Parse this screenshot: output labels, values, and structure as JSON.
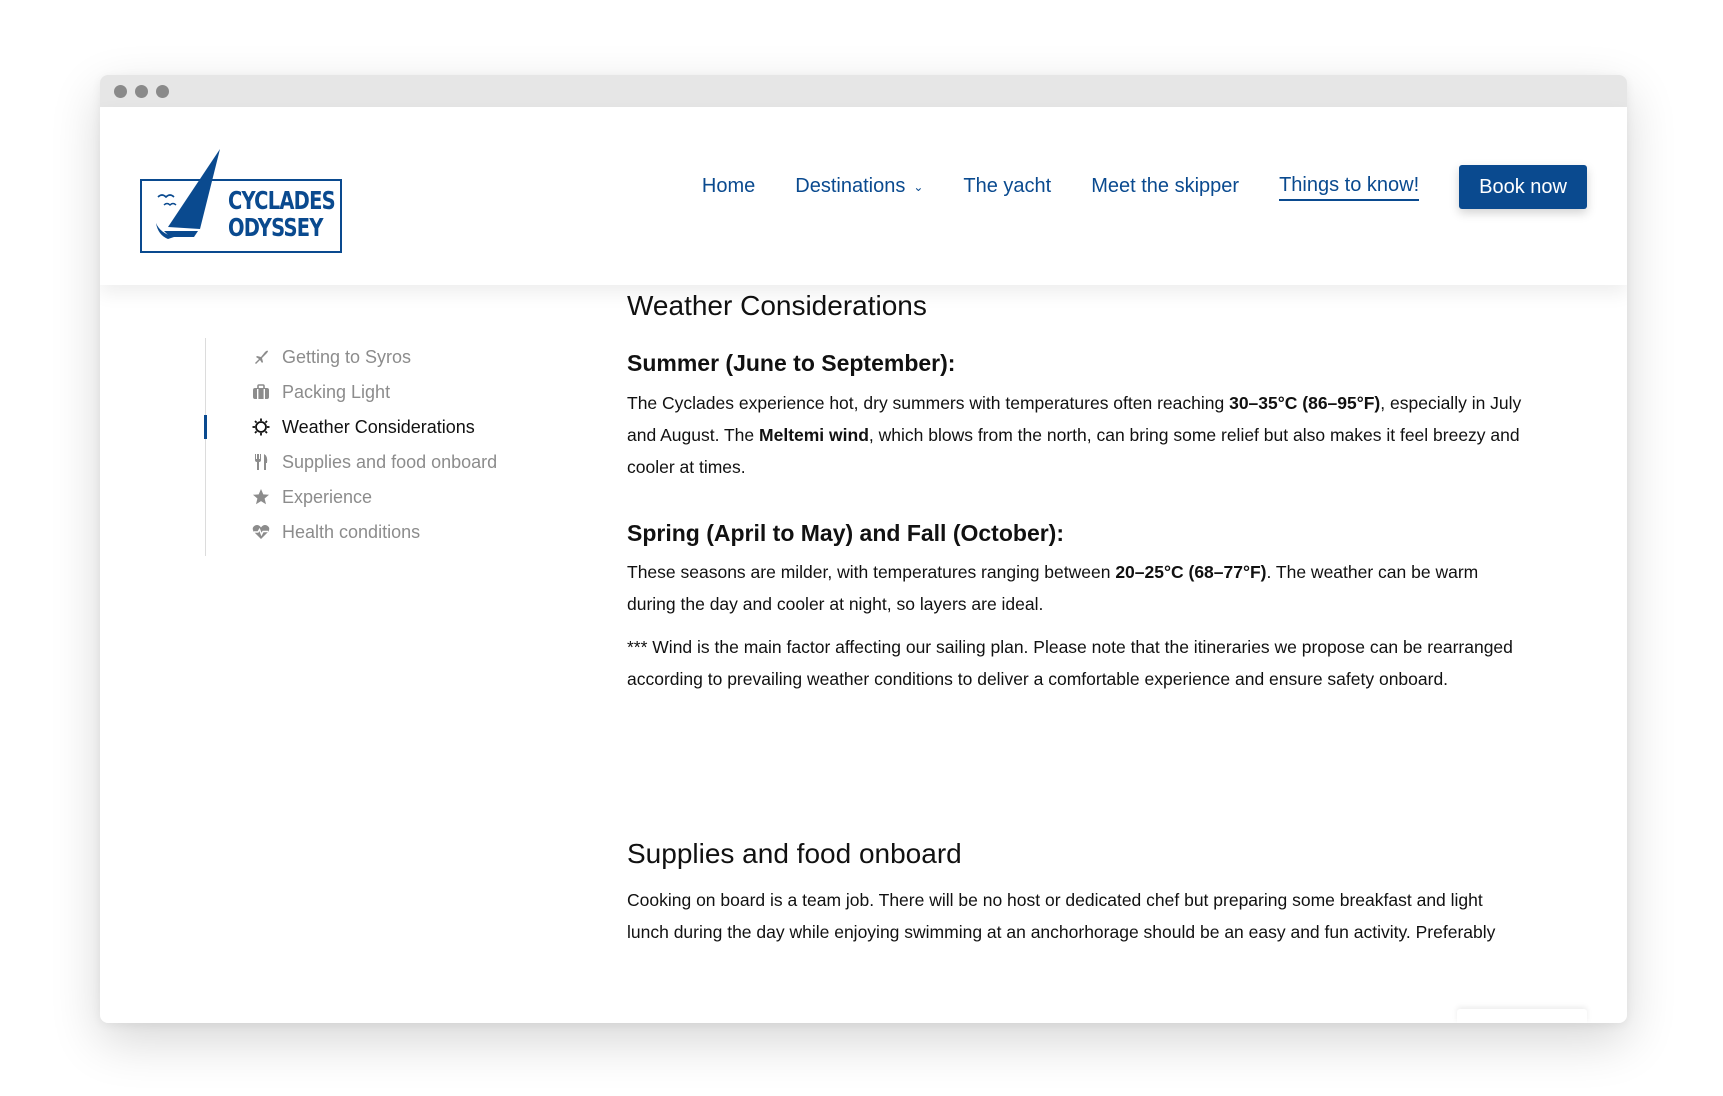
{
  "logo": {
    "line1": "CYCLADES",
    "line2": "ODYSSEY"
  },
  "nav": {
    "items": [
      {
        "label": "Home"
      },
      {
        "label": "Destinations",
        "has_dropdown": true
      },
      {
        "label": "The yacht"
      },
      {
        "label": "Meet the skipper"
      },
      {
        "label": "Things to know!",
        "active": true
      }
    ],
    "book_label": "Book now"
  },
  "sidebar": {
    "items": [
      {
        "label": "Getting to Syros",
        "icon": "plane-icon"
      },
      {
        "label": "Packing Light",
        "icon": "suitcase-icon"
      },
      {
        "label": "Weather Considerations",
        "icon": "sun-icon",
        "active": true
      },
      {
        "label": "Supplies and food onboard",
        "icon": "utensils-icon"
      },
      {
        "label": "Experience",
        "icon": "star-icon"
      },
      {
        "label": "Health conditions",
        "icon": "heartbeat-icon"
      }
    ]
  },
  "weather": {
    "title": "Weather Considerations",
    "summer": {
      "heading": "Summer (June to September):",
      "t1": "The Cyclades experience hot, dry summers with temperatures often reaching ",
      "b1": "30–35°C (86–95°F)",
      "t2": ", especially in July and August. The ",
      "b2": "Meltemi wind",
      "t3": ", which blows from the north, can bring some relief but also makes it feel breezy and cooler at times."
    },
    "spring": {
      "heading": "Spring (April to May) and Fall (October):",
      "t1": "These seasons are milder, with temperatures ranging between ",
      "b1": "20–25°C (68–77°F)",
      "t2": ". The weather can be warm during the day and cooler at night, so layers are ideal."
    },
    "note": "*** Wind is the main factor affecting our sailing plan. Please note that the itineraries we propose can be rearranged according to prevailing weather conditions to deliver a comfortable experience and ensure safety onboard."
  },
  "supplies": {
    "title": "Supplies and food onboard",
    "text": "Cooking on board is a team job. There will be no host or dedicated chef but preparing some breakfast and light lunch during the day while enjoying swimming at an anchorhorage should be an easy and fun activity. Preferably"
  },
  "colors": {
    "brand": "#0a4a8f",
    "muted": "#8c8c8c"
  }
}
